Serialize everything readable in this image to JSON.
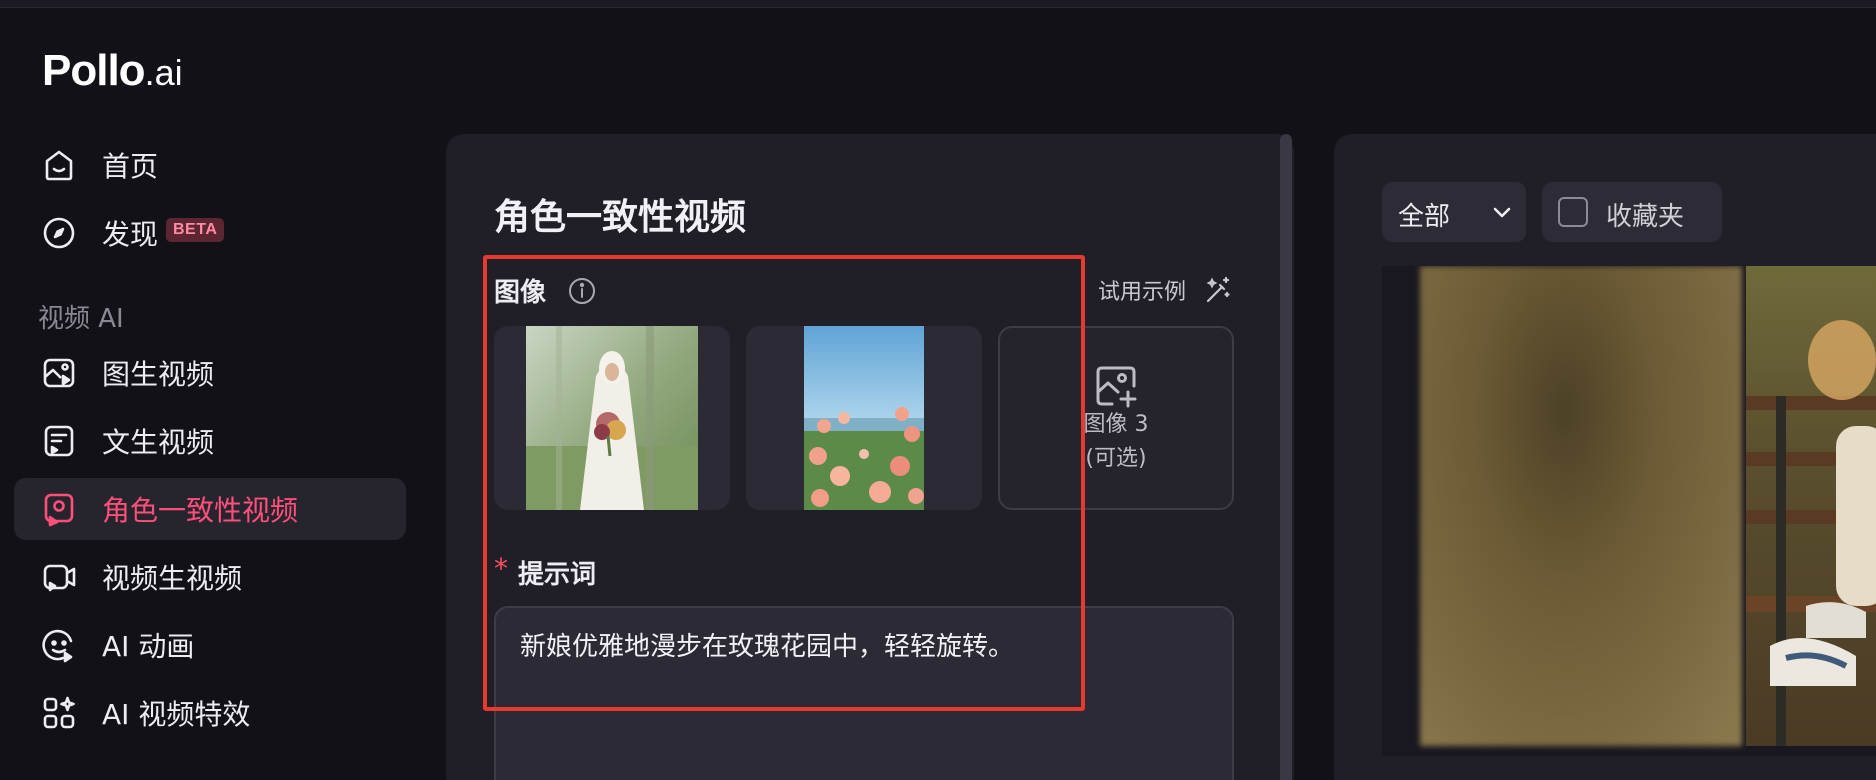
{
  "app": {
    "logo_main": "Pollo",
    "logo_suffix": ".ai"
  },
  "sidebar": {
    "items_top": [
      {
        "label": "首页",
        "icon": "home-icon"
      },
      {
        "label": "发现",
        "icon": "compass-icon",
        "badge": "BETA"
      }
    ],
    "section_label": "视频 AI",
    "items_video": [
      {
        "label": "图生视频",
        "icon": "image-to-video-icon"
      },
      {
        "label": "文生视频",
        "icon": "text-to-video-icon"
      },
      {
        "label": "角色一致性视频",
        "icon": "character-video-icon",
        "active": true
      },
      {
        "label": "视频生视频",
        "icon": "video-to-video-icon"
      },
      {
        "label": "AI 动画",
        "icon": "ai-animation-icon"
      },
      {
        "label": "AI 视频特效",
        "icon": "ai-effects-icon"
      }
    ]
  },
  "main": {
    "title": "角色一致性视频",
    "image_field": {
      "label": "图像",
      "try_example": "试用示例",
      "slot3_line1": "图像 3",
      "slot3_line2": "(可选)"
    },
    "prompt_field": {
      "required_mark": "*",
      "label": "提示词",
      "value": "新娘优雅地漫步在玫瑰花园中，轻轻旋转。"
    }
  },
  "right": {
    "filter_label": "全部",
    "favorites_label": "收藏夹"
  },
  "colors": {
    "accent": "#ff4f7a",
    "highlight_box": "#e8392e",
    "background": "#121118",
    "panel": "#201f28"
  }
}
